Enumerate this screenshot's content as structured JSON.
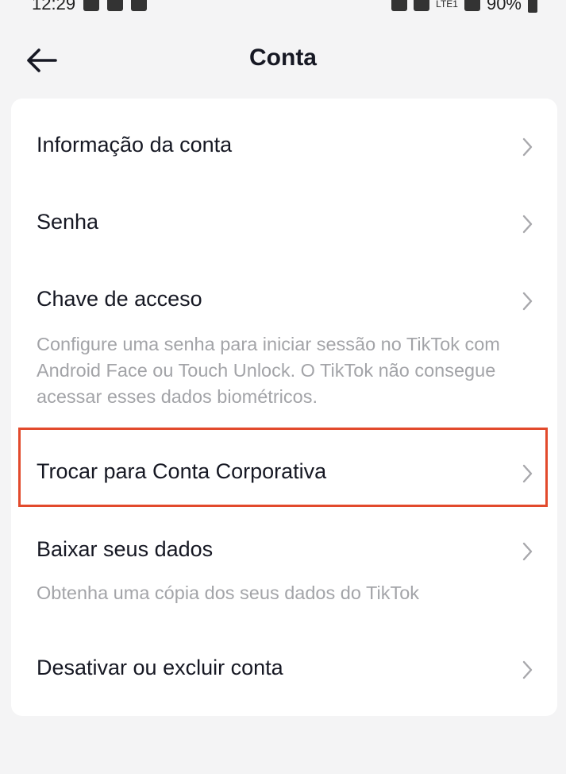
{
  "status_bar": {
    "time": "12:29",
    "battery": "90%",
    "network": "LTE1"
  },
  "header": {
    "title": "Conta",
    "back_icon": "arrow-left-icon"
  },
  "menu": {
    "items": [
      {
        "label": "Informação da conta",
        "icon": "chevron-right-icon"
      },
      {
        "label": "Senha",
        "icon": "chevron-right-icon"
      },
      {
        "label": "Chave de acceso",
        "description": "Configure uma senha para iniciar sessão no TikTok com Android Face ou Touch Unlock. O TikTok não consegue acessar esses dados biométricos.",
        "icon": "chevron-right-icon"
      },
      {
        "label": "Trocar para Conta Corporativa",
        "icon": "chevron-right-icon",
        "highlighted": true
      },
      {
        "label": "Baixar seus dados",
        "description": "Obtenha uma cópia dos seus dados do TikTok",
        "icon": "chevron-right-icon"
      },
      {
        "label": "Desativar ou excluir conta",
        "icon": "chevron-right-icon"
      }
    ]
  },
  "colors": {
    "background": "#f4f4f5",
    "card": "#ffffff",
    "text": "#161823",
    "secondary_text": "#a3a4a8",
    "chevron": "#a8a8ac",
    "highlight": "#e24a2c"
  }
}
